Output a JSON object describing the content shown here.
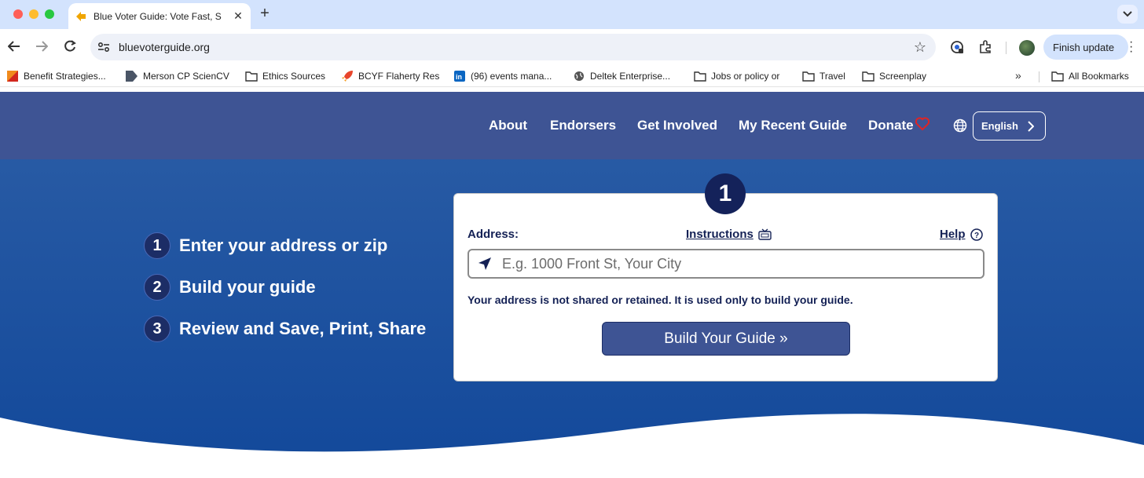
{
  "browser": {
    "tab_title": "Blue Voter Guide: Vote Fast, S",
    "url": "bluevoterguide.org",
    "finish_update": "Finish update",
    "bookmarks": [
      {
        "label": "Benefit Strategies...",
        "icon": "benefit-favicon"
      },
      {
        "label": "Merson CP ScienCV",
        "icon": "sciencv-favicon"
      },
      {
        "label": "Ethics Sources",
        "icon": "folder-icon"
      },
      {
        "label": "BCYF Flaherty Res",
        "icon": "rocket-favicon"
      },
      {
        "label": "(96) events mana...",
        "icon": "linkedin-favicon"
      },
      {
        "label": "Deltek Enterprise...",
        "icon": "globe-favicon"
      },
      {
        "label": "Jobs or policy or",
        "icon": "folder-icon"
      },
      {
        "label": "Travel",
        "icon": "folder-icon"
      },
      {
        "label": "Screenplay",
        "icon": "folder-icon"
      }
    ],
    "all_bookmarks": "All Bookmarks"
  },
  "nav": {
    "about": "About",
    "endorsers": "Endorsers",
    "get_involved": "Get Involved",
    "recent_guide": "My Recent Guide",
    "donate": "Donate",
    "language": "English"
  },
  "steps": [
    {
      "num": "1",
      "text": "Enter your address or zip"
    },
    {
      "num": "2",
      "text": "Build your guide"
    },
    {
      "num": "3",
      "text": "Review and Save, Print, Share"
    }
  ],
  "card": {
    "badge": "1",
    "address_label": "Address:",
    "instructions": "Instructions",
    "help": "Help",
    "address_placeholder": "E.g. 1000 Front St, Your City",
    "address_value": "",
    "privacy_note": "Your address is not shared or retained. It is used only to build your guide.",
    "build_button": "Build Your Guide »"
  },
  "colors": {
    "nav_bg": "#3e5494",
    "hero_top": "#2c5ea6",
    "hero_bottom": "#12489a",
    "badge": "#14225a",
    "button": "#3e5494",
    "heart": "#e02424"
  }
}
